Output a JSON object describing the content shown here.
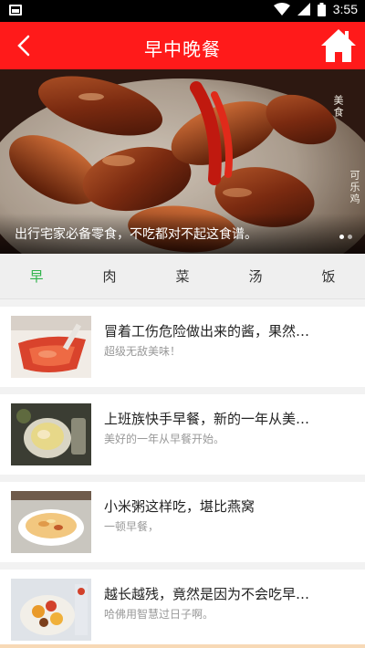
{
  "status": {
    "time": "3:55"
  },
  "header": {
    "title": "早中晚餐"
  },
  "banner": {
    "caption": "出行宅家必备零食，不吃都对不起这食谱。",
    "stamp_a": "美食",
    "stamp_b": "可乐鸡"
  },
  "tabs": [
    {
      "label": "早",
      "active": true
    },
    {
      "label": "肉"
    },
    {
      "label": "菜"
    },
    {
      "label": "汤"
    },
    {
      "label": "饭"
    }
  ],
  "recipes": [
    {
      "title": "冒着工伤危险做出来的酱，果然…",
      "subtitle": "超级无敌美味！"
    },
    {
      "title": "上班族快手早餐，新的一年从美…",
      "subtitle": "美好的一年从早餐开始。"
    },
    {
      "title": "小米粥这样吃，堪比燕窝",
      "subtitle": "一顿早餐，"
    },
    {
      "title": "越长越残，竟然是因为不会吃早…",
      "subtitle": "哈佛用智慧过日子啊。"
    }
  ],
  "colors": {
    "brand_red": "#ff1a1a",
    "active_tab": "#2fb34a"
  }
}
